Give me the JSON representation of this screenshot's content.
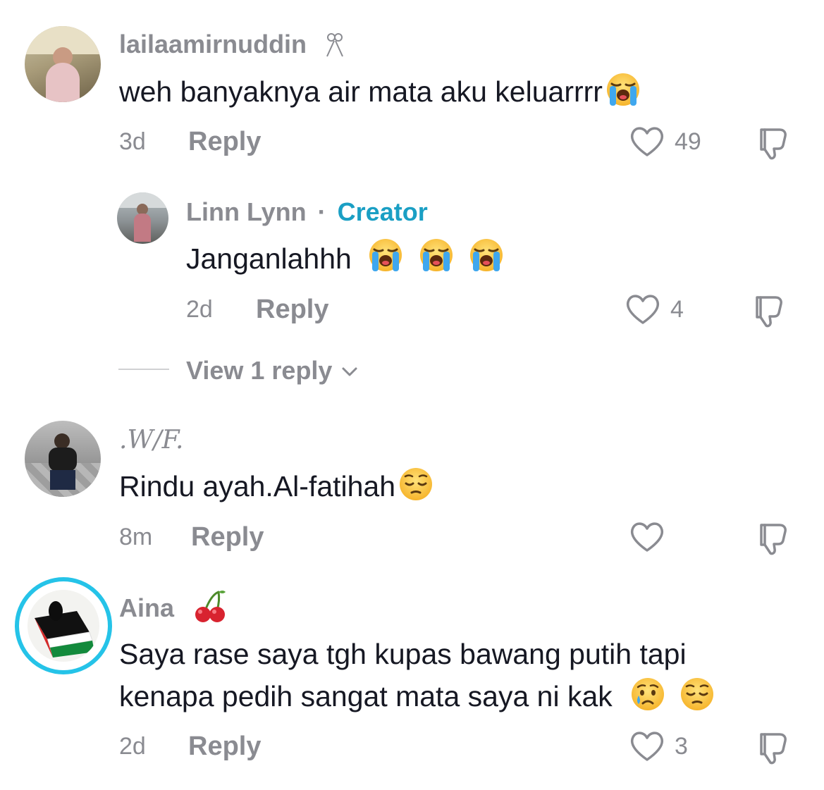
{
  "comments": [
    {
      "username": "lailaamirnuddin",
      "badge_icon": "ribbon-icon",
      "text": "weh banyaknya air mata aku keluarrrr",
      "emojis": [
        "loudly-crying-face"
      ],
      "age": "3d",
      "reply_label": "Reply",
      "likes": "49"
    },
    {
      "username": "Linn Lynn",
      "separator": "·",
      "role": "Creator",
      "text": "Janganlahhh",
      "emojis": [
        "loudly-crying-face",
        "loudly-crying-face",
        "loudly-crying-face"
      ],
      "age": "2d",
      "reply_label": "Reply",
      "likes": "4"
    },
    {
      "username": ".W/F.",
      "text": "Rindu ayah.Al-fatihah",
      "emojis": [
        "pensive-face"
      ],
      "age": "8m",
      "reply_label": "Reply",
      "likes": ""
    },
    {
      "username": "Aina",
      "badge_icon": "cherries-icon",
      "text_lines": [
        "Saya rase saya tgh kupas bawang putih tapi",
        "kenapa pedih sangat mata saya ni kak"
      ],
      "emojis": [
        "crying-face",
        "pensive-face"
      ],
      "age": "2d",
      "reply_label": "Reply",
      "likes": "3"
    }
  ],
  "view_replies": {
    "label": "View 1 reply"
  },
  "colors": {
    "creator": "#1a9fc4",
    "muted": "#8a8b91",
    "text": "#161823",
    "story_ring": "#25c3e8"
  }
}
